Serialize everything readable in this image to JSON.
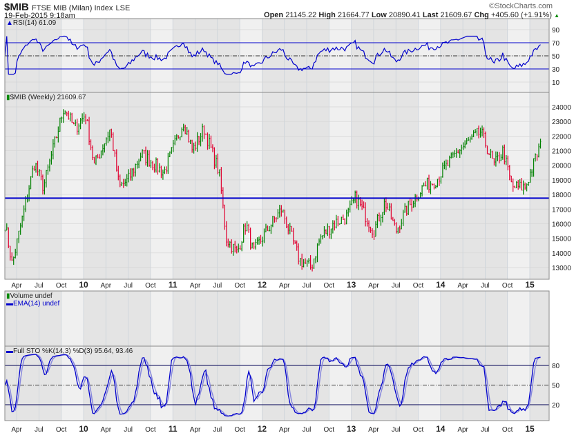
{
  "header": {
    "symbol": "$MIB",
    "name": "FTSE MIB (Milan) Index",
    "exchange": "LSE",
    "datetime": "19-Feb-2015 9:18am",
    "brand": "©StockCharts.com",
    "open_label": "Open",
    "open": "21145.22",
    "high_label": "High",
    "high": "21664.77",
    "low_label": "Low",
    "low": "20890.41",
    "last_label": "Last",
    "last": "21609.67",
    "chg_label": "Chg",
    "chg": "+405.60 (+1.91%)"
  },
  "panels": {
    "rsi_label": "RSI(14) 61.09",
    "price_label": "$MIB (Weekly) 21609.67",
    "volume_label": "Volume undef",
    "ema_label": "EMA(14) undef",
    "sto_label": "Full STO %K(14,3) %D(3) 95.64, 93.46"
  },
  "colors": {
    "up": "#008000",
    "down": "#e00030",
    "line": "#0000cc",
    "sto_d": "#8888dd"
  },
  "chart_data": {
    "type": "candlestick",
    "title": "$MIB (Weekly)",
    "x_ticks": [
      "Apr",
      "Jul",
      "Oct",
      "10",
      "Apr",
      "Jul",
      "Oct",
      "11",
      "Apr",
      "Jul",
      "Oct",
      "12",
      "Apr",
      "Jul",
      "Oct",
      "13",
      "Apr",
      "Jul",
      "Oct",
      "14",
      "Apr",
      "Jul",
      "Oct",
      "15"
    ],
    "price_ticks": [
      24000,
      23000,
      22000,
      21000,
      20000,
      19000,
      18000,
      17000,
      16000,
      15000,
      14000,
      13000
    ],
    "price_ylim": [
      12300,
      24900
    ],
    "support_line": 17750,
    "rsi_ticks": [
      90,
      70,
      50,
      30,
      10
    ],
    "rsi_lines": [
      70,
      50,
      30
    ],
    "sto_ticks": [
      80,
      50,
      20
    ],
    "sto_lines": [
      80,
      50,
      20
    ],
    "close_keypoints": [
      [
        2009.12,
        16000
      ],
      [
        2009.2,
        13200
      ],
      [
        2009.45,
        20200
      ],
      [
        2009.55,
        18500
      ],
      [
        2009.78,
        24000
      ],
      [
        2009.9,
        22500
      ],
      [
        2010.02,
        23500
      ],
      [
        2010.12,
        20000
      ],
      [
        2010.3,
        22500
      ],
      [
        2010.4,
        18500
      ],
      [
        2010.5,
        19000
      ],
      [
        2010.65,
        20800
      ],
      [
        2010.9,
        19500
      ],
      [
        2011.12,
        23000
      ],
      [
        2011.22,
        21000
      ],
      [
        2011.35,
        22500
      ],
      [
        2011.52,
        19500
      ],
      [
        2011.6,
        15000
      ],
      [
        2011.72,
        14000
      ],
      [
        2011.82,
        16000
      ],
      [
        2011.9,
        14000
      ],
      [
        2012.05,
        15500
      ],
      [
        2012.22,
        17000
      ],
      [
        2012.42,
        13500
      ],
      [
        2012.55,
        13000
      ],
      [
        2012.65,
        15000
      ],
      [
        2012.8,
        16000
      ],
      [
        2012.95,
        16500
      ],
      [
        2013.05,
        17800
      ],
      [
        2013.25,
        15500
      ],
      [
        2013.38,
        17500
      ],
      [
        2013.5,
        15500
      ],
      [
        2013.62,
        17000
      ],
      [
        2013.8,
        18500
      ],
      [
        2013.95,
        19000
      ],
      [
        2014.2,
        21000
      ],
      [
        2014.45,
        22300
      ],
      [
        2014.6,
        20000
      ],
      [
        2014.7,
        21000
      ],
      [
        2014.8,
        18500
      ],
      [
        2014.95,
        18500
      ],
      [
        2015.13,
        21610
      ]
    ]
  }
}
